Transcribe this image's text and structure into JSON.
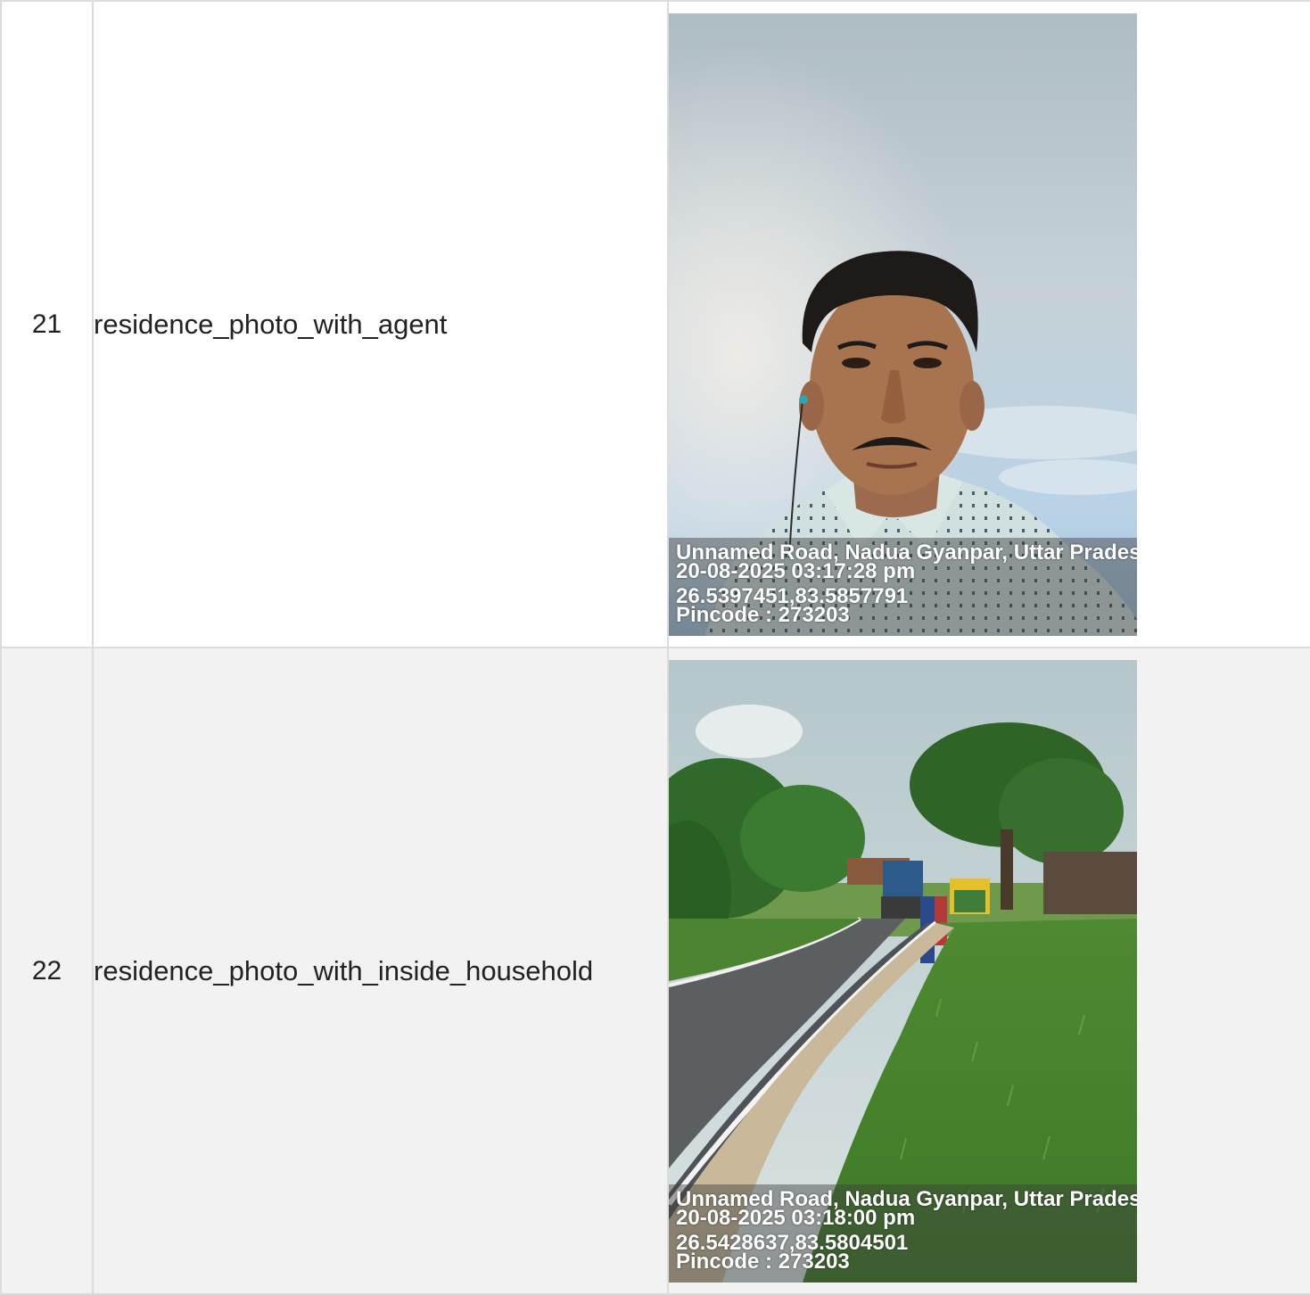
{
  "rows": [
    {
      "sno": "21",
      "label": "residence_photo_with_agent",
      "photo": {
        "subject": "selfie of agent against sky",
        "address": "Unnamed Road, Nadua Gyanpar, Uttar Prades",
        "datetime": "20-08-2025 03:17:28 pm",
        "coords": "26.5397451,83.5857791",
        "pincode": "Pincode : 273203"
      }
    },
    {
      "sno": "22",
      "label": "residence_photo_with_inside_household",
      "photo": {
        "subject": "village road with trees and tractor",
        "address": "Unnamed Road, Nadua Gyanpar, Uttar Prades",
        "datetime": "20-08-2025 03:18:00 pm",
        "coords": "26.5428637,83.5804501",
        "pincode": "Pincode : 273203"
      }
    }
  ]
}
